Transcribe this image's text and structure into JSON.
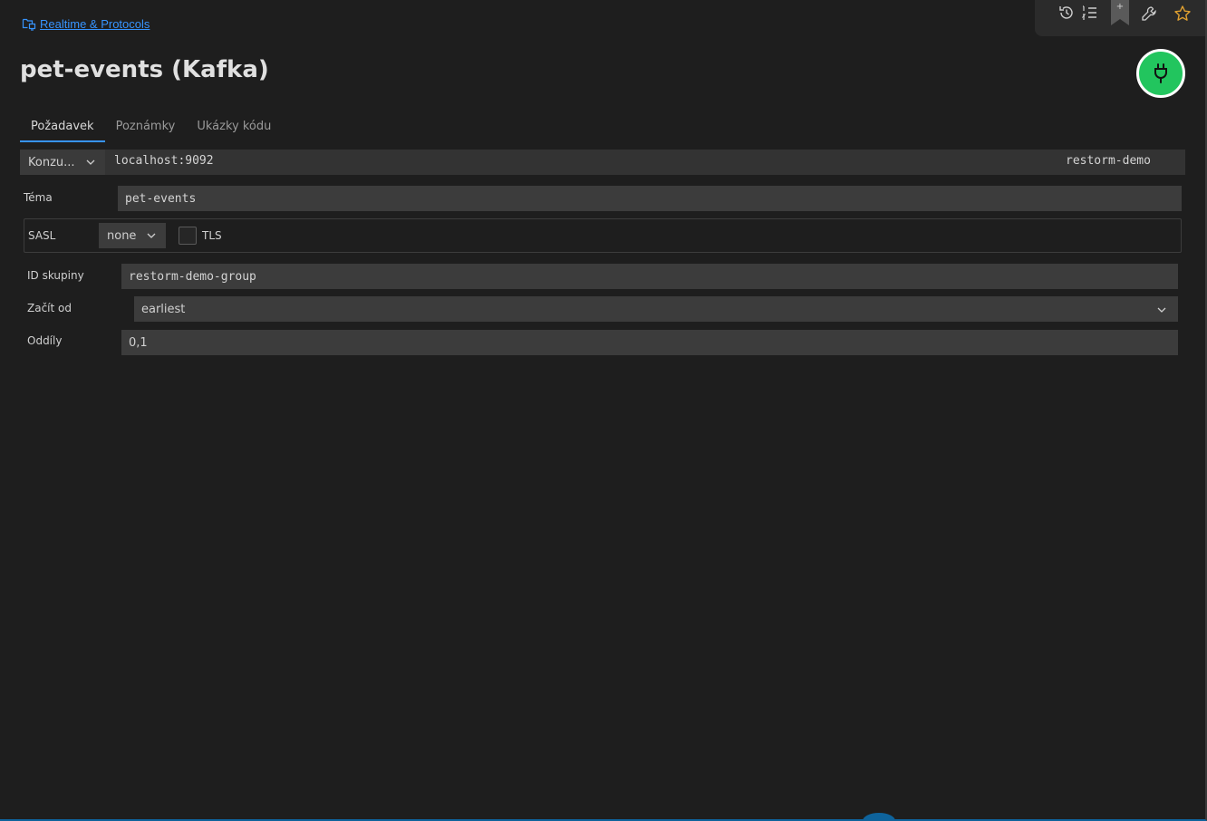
{
  "breadcrumb": {
    "icon": "folder-network-icon",
    "label": "Realtime & Protocols"
  },
  "title": "pet-events (Kafka)",
  "toolbar": {
    "icons": [
      "history-icon",
      "list-ordered-icon",
      "bookmark-add-icon",
      "wrench-icon",
      "star-icon"
    ],
    "bookmark_plus": "+"
  },
  "connect_button": {
    "icon": "plug-icon",
    "color": "#22c55e"
  },
  "tabs": [
    {
      "label": "Požadavek",
      "active": true
    },
    {
      "label": "Poznámky",
      "active": false
    },
    {
      "label": "Ukázky kódu",
      "active": false
    }
  ],
  "connection": {
    "mode": "Konzu...",
    "host": "localhost:9092",
    "profile": "restorm-demo"
  },
  "topic": {
    "label": "Téma",
    "value": "pet-events"
  },
  "sasl": {
    "label": "SASL",
    "value": "none",
    "tls_label": "TLS",
    "tls_checked": false
  },
  "group_id": {
    "label": "ID skupiny",
    "value": "restorm-demo-group"
  },
  "start_from": {
    "label": "Začít od",
    "value": "earliest"
  },
  "partitions": {
    "label": "Oddíly",
    "value": "0,1"
  },
  "colors": {
    "accent": "#3794ff",
    "background": "#1e1e1e",
    "field": "#3c3c3c",
    "success": "#22c55e"
  }
}
